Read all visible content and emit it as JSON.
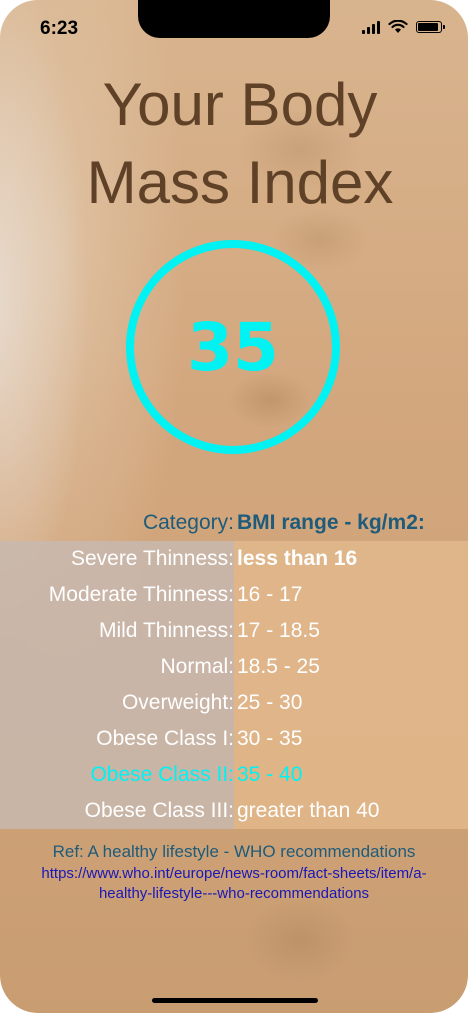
{
  "status_bar": {
    "time": "6:23",
    "battery_level": 0.9
  },
  "title_line1": "Your Body",
  "title_line2": "Mass Index",
  "bmi_value": "35",
  "table": {
    "header": {
      "category": "Category:",
      "range": "BMI range - kg/m2:"
    },
    "rows": [
      {
        "category": "Severe Thinness:",
        "range": "less than 16"
      },
      {
        "category": "Moderate Thinness:",
        "range": "16 - 17"
      },
      {
        "category": "Mild Thinness:",
        "range": "17 - 18.5"
      },
      {
        "category": "Normal:",
        "range": "18.5 - 25"
      },
      {
        "category": "Overweight:",
        "range": "25 - 30"
      },
      {
        "category": "Obese Class I:",
        "range": "30 - 35"
      },
      {
        "category": "Obese Class II:",
        "range": "35 - 40"
      },
      {
        "category": "Obese Class III:",
        "range": "greater than 40"
      }
    ],
    "highlight_color": "#00f2f2"
  },
  "reference": {
    "text": "Ref: A healthy lifestyle - WHO recommendations",
    "link_line1": "https://www.who.int/europe/news-room/fact-sheets/item/a-",
    "link_line2": "healthy-lifestyle---who-recommendations"
  },
  "colors": {
    "title": "#5e4127",
    "accent": "#00f2f2",
    "header_text": "#1f5b7a",
    "link": "#1a17b8"
  }
}
